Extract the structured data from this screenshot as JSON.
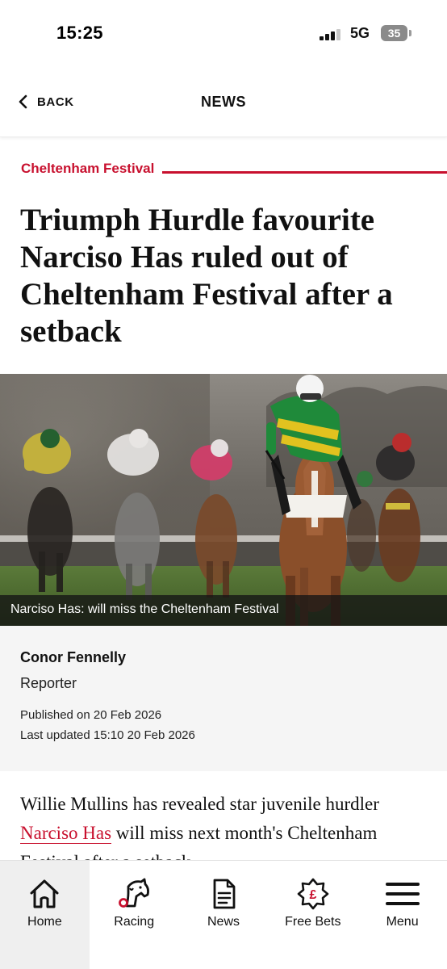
{
  "status_bar": {
    "time": "15:25",
    "network": "5G",
    "battery": "35"
  },
  "nav": {
    "back_label": "BACK",
    "title": "NEWS"
  },
  "article": {
    "category": "Cheltenham Festival",
    "headline": "Triumph Hurdle favourite Narciso Has ruled out of Cheltenham Festival after a setback",
    "image_caption": "Narciso Has: will miss the Cheltenham Festival",
    "author": {
      "name": "Conor Fennelly",
      "role": "Reporter"
    },
    "published": "Published on 20 Feb 2026",
    "updated": "Last updated 15:10 20 Feb 2026",
    "body_intro": "Willie Mullins has revealed star juvenile hurdler",
    "body_link": "Narciso Has",
    "body_rest": "will miss next month's Cheltenham Festival after a setback"
  },
  "colors": {
    "accent": "#c8102e",
    "text": "#111111",
    "panel": "#f5f5f5"
  },
  "tab_bar": {
    "tabs": [
      {
        "label": "Home",
        "icon": "home-icon",
        "active": true
      },
      {
        "label": "Racing",
        "icon": "horse-head-icon",
        "active": false
      },
      {
        "label": "News",
        "icon": "document-icon",
        "active": false
      },
      {
        "label": "Free Bets",
        "icon": "pound-star-icon",
        "active": false
      },
      {
        "label": "Menu",
        "icon": "hamburger-icon",
        "active": false
      }
    ]
  }
}
